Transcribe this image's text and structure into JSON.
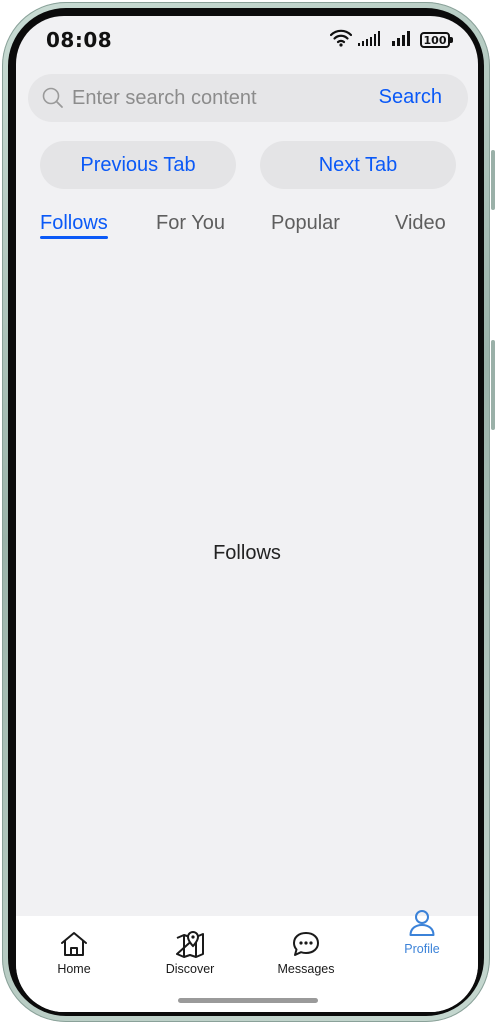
{
  "status_bar": {
    "time": "08:08",
    "battery": "100",
    "icons": [
      "wifi-icon",
      "signal-icon",
      "signal-icon",
      "battery-icon"
    ]
  },
  "search": {
    "placeholder": "Enter search content",
    "value": "",
    "button_label": "Search"
  },
  "tab_controls": {
    "previous_label": "Previous Tab",
    "next_label": "Next Tab"
  },
  "tabs": [
    {
      "label": "Follows",
      "active": true
    },
    {
      "label": "For You",
      "active": false
    },
    {
      "label": "Popular",
      "active": false
    },
    {
      "label": "Video",
      "active": false
    }
  ],
  "content": {
    "label": "Follows"
  },
  "bottom_nav": [
    {
      "label": "Home",
      "icon": "home-icon",
      "active": false
    },
    {
      "label": "Discover",
      "icon": "map-pin-icon",
      "active": false
    },
    {
      "label": "Messages",
      "icon": "chat-bubble-icon",
      "active": false
    },
    {
      "label": "Profile",
      "icon": "person-icon",
      "active": true
    }
  ],
  "colors": {
    "accent": "#0a59f7",
    "nav_active": "#3b82d8",
    "background": "#f1f1f3"
  }
}
